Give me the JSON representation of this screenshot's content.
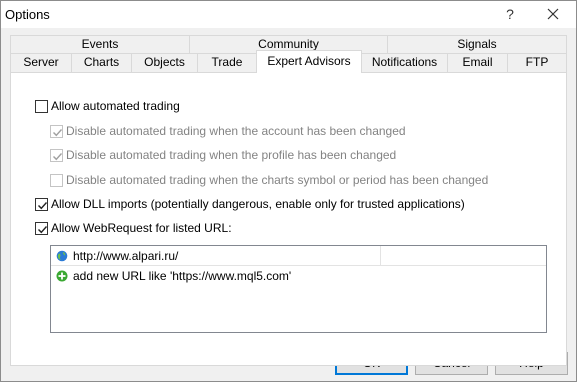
{
  "window": {
    "title": "Options",
    "help_glyph": "?"
  },
  "tabs": {
    "row1": [
      {
        "label": "Events"
      },
      {
        "label": "Community"
      },
      {
        "label": "Signals"
      }
    ],
    "row2": [
      {
        "label": "Server"
      },
      {
        "label": "Charts"
      },
      {
        "label": "Objects"
      },
      {
        "label": "Trade"
      },
      {
        "label": "Expert Advisors"
      },
      {
        "label": "Notifications"
      },
      {
        "label": "Email"
      },
      {
        "label": "FTP"
      }
    ],
    "active": "Expert Advisors"
  },
  "options": [
    {
      "label": "Allow automated trading",
      "checked": false,
      "enabled": true
    },
    {
      "label": "Disable automated trading when the account has been changed",
      "checked": true,
      "enabled": false
    },
    {
      "label": "Disable automated trading when the profile has been changed",
      "checked": true,
      "enabled": false
    },
    {
      "label": "Disable automated trading when the charts symbol or period has been changed",
      "checked": false,
      "enabled": false
    },
    {
      "label": "Allow DLL imports (potentially dangerous, enable only for trusted applications)",
      "checked": true,
      "enabled": true
    },
    {
      "label": "Allow WebRequest for listed URL:",
      "checked": true,
      "enabled": true
    }
  ],
  "url_list": {
    "items": [
      {
        "text": "http://www.alpari.ru/",
        "icon": "globe-icon"
      },
      {
        "text": "add new URL like 'https://www.mql5.com'",
        "icon": "add-icon"
      }
    ]
  },
  "buttons": {
    "ok": "OK",
    "cancel": "Cancel",
    "help": "Help"
  },
  "colors": {
    "dialog_bg": "#f0f0f0",
    "panel_bg": "#ffffff",
    "disabled_text": "#838383",
    "default_button_border": "#0078d7",
    "add_icon_green": "#3aa832",
    "globe_blue": "#2b7bd6"
  }
}
